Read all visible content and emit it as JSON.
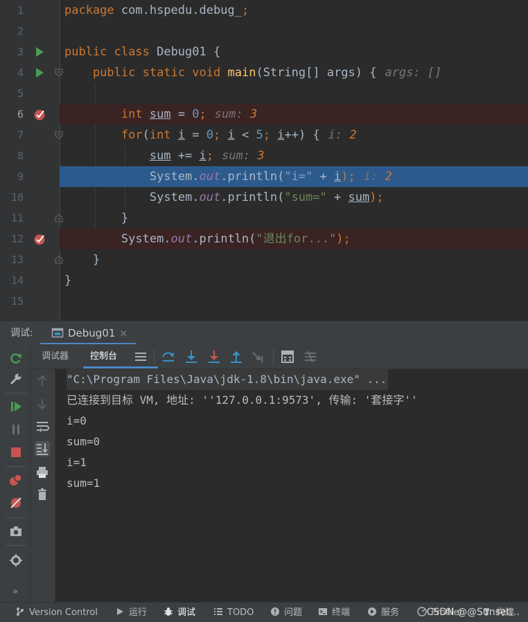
{
  "editor": {
    "line_numbers": [
      "1",
      "2",
      "3",
      "4",
      "5",
      "6",
      "7",
      "8",
      "9",
      "10",
      "11",
      "12",
      "13",
      "14",
      "15"
    ],
    "lines": {
      "l1": {
        "kw1": "package",
        "rest": " com.hspedu.debug_",
        "semi": ";"
      },
      "l3": {
        "kw1": "public",
        "kw2": "class",
        "name": " Debug01 {"
      },
      "l4": {
        "kw1": "public",
        "kw2": "static",
        "kw3": "void",
        "fn": "main",
        "params": "(String[] args) {",
        "hint_text": "args: []"
      },
      "l6": {
        "kw1": "int",
        "var": "sum",
        "op": " = ",
        "num": "0",
        "semi": ";",
        "hint_name": "sum:",
        "hint_val": "3"
      },
      "l7": {
        "kw1": "for",
        "open": "(",
        "kw2": "int",
        "var": "i",
        "op1": " = ",
        "num1": "0",
        "semi1": "; ",
        "var2": "i",
        "op2": " < ",
        "num2": "5",
        "semi2": "; ",
        "var3": "i",
        "tail": "++) {",
        "hint_name": "i:",
        "hint_val": "2"
      },
      "l8": {
        "var": "sum",
        "op": " += ",
        "var2": "i",
        "semi": ";",
        "hint_name": "sum:",
        "hint_val": "3"
      },
      "l9": {
        "cls": "System.",
        "fld": "out",
        "call": ".println(",
        "str": "\"i=\"",
        "plus": " + ",
        "var": "i",
        "close": ");",
        "hint_name": "i:",
        "hint_val": "2"
      },
      "l10": {
        "cls": "System.",
        "fld": "out",
        "call": ".println(",
        "str": "\"sum=\"",
        "plus": " + ",
        "var": "sum",
        "close": ");"
      },
      "l11": {
        "brace": "}"
      },
      "l12": {
        "cls": "System.",
        "fld": "out",
        "call": ".println(",
        "str": "\"退出for...\"",
        "close": ");"
      },
      "l13": {
        "brace": "}"
      },
      "l14": {
        "brace": "}"
      }
    }
  },
  "debug_panel": {
    "label": "调试:",
    "tab": {
      "label": "Debug01",
      "close": "×"
    },
    "subtabs": {
      "debugger": "调试器",
      "console": "控制台"
    }
  },
  "console": {
    "lines": [
      "\"C:\\Program Files\\Java\\jdk-1.8\\bin\\java.exe\" ...",
      "已连接到目标 VM, 地址: ''127.0.0.1:9573', 传输: '套接字''",
      "i=0",
      "sum=0",
      "i=1",
      "sum=1"
    ]
  },
  "statusbar": {
    "items": {
      "vcs": "Version Control",
      "run": "运行",
      "debug": "调试",
      "todo": "TODO",
      "problems": "问题",
      "terminal": "终端",
      "services": "服务",
      "profiler": "Profiler",
      "build": "构建"
    },
    "watermark": "CSDN @@Sunset…"
  },
  "colors": {
    "editor_bg": "#2b2b2b",
    "keyword": "#cc7832",
    "function": "#ffc66d",
    "number": "#6897bb",
    "string": "#6a8759",
    "field": "#9876aa",
    "exec_line": "#2d5a8c",
    "breakpoint_line": "#3a2323",
    "breakpoint": "#c75450",
    "run_green": "#499c54",
    "accent_blue": "#4a88c7"
  },
  "icons": {
    "run_gutter": "run-triangle-icon",
    "breakpoint": "breakpoint-check-icon",
    "fold": "fold-marker-icon"
  }
}
